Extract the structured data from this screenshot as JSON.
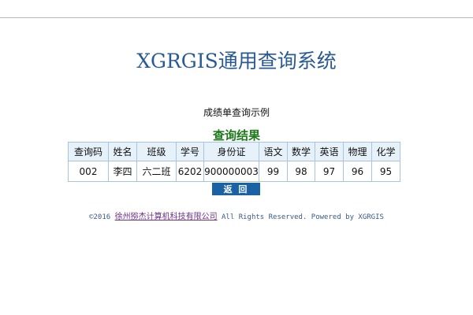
{
  "page": {
    "title": "XGRGIS通用查询系统",
    "subtitle": "成绩单查询示例",
    "result_heading": "查询结果"
  },
  "table": {
    "headers": [
      "查询码",
      "姓名",
      "班级",
      "学号",
      "身份证",
      "语文",
      "数学",
      "英语",
      "物理",
      "化学"
    ],
    "rows": [
      [
        "002",
        "李四",
        "六二班",
        "6202",
        "900000003",
        "99",
        "98",
        "97",
        "96",
        "95"
      ]
    ]
  },
  "actions": {
    "back_label": "返 回"
  },
  "footer": {
    "copyright": "©2016",
    "company_link": "徐州猕杰计算机科技有限公司",
    "rights": "All Rights Reserved. Powered by XGRGIS"
  },
  "colors": {
    "title": "#2a5a93",
    "heading": "#1c7a18",
    "button": "#1a62a3",
    "header_cell": "#e6f1fa",
    "table_border": "#a9c5dd",
    "link": "#6b2f86"
  }
}
